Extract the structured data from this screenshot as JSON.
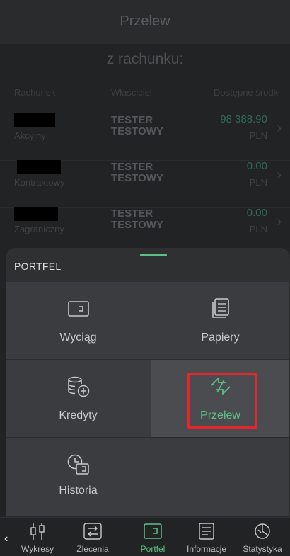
{
  "header": {
    "title": "Przelew",
    "subtitle": "z rachunku:"
  },
  "table": {
    "columns": [
      "Rachunek",
      "Właściciel",
      "Dostępne środki"
    ],
    "rows": [
      {
        "type": "Akcyjny",
        "owner_line1": "TESTER",
        "owner_line2": "TESTOWY",
        "amount": "98 388.90",
        "currency": "PLN"
      },
      {
        "type": "Kontraktowy",
        "owner_line1": "TESTER",
        "owner_line2": "TESTOWY",
        "amount": "0.00",
        "currency": "PLN"
      },
      {
        "type": "Zagraniczny",
        "owner_line1": "TESTER",
        "owner_line2": "TESTOWY",
        "amount": "0.00",
        "currency": "PLN"
      }
    ]
  },
  "sheet": {
    "label": "PORTFEL",
    "tiles": [
      {
        "label": "Wyciąg",
        "icon": "wallet-icon"
      },
      {
        "label": "Papiery",
        "icon": "documents-icon"
      },
      {
        "label": "Kredyty",
        "icon": "coins-add-icon"
      },
      {
        "label": "Przelew",
        "icon": "transfer-icon",
        "selected": true
      },
      {
        "label": "Historia",
        "icon": "history-icon"
      }
    ]
  },
  "bottom_nav": [
    {
      "label": "Wykresy",
      "icon": "candlestick-icon"
    },
    {
      "label": "Zlecenia",
      "icon": "orders-icon"
    },
    {
      "label": "Portfel",
      "icon": "wallet-icon",
      "active": true
    },
    {
      "label": "Informacje",
      "icon": "news-icon"
    },
    {
      "label": "Statystyka",
      "icon": "stats-icon"
    }
  ],
  "colors": {
    "accent": "#5fbf87",
    "highlight_box": "#e5272d"
  }
}
